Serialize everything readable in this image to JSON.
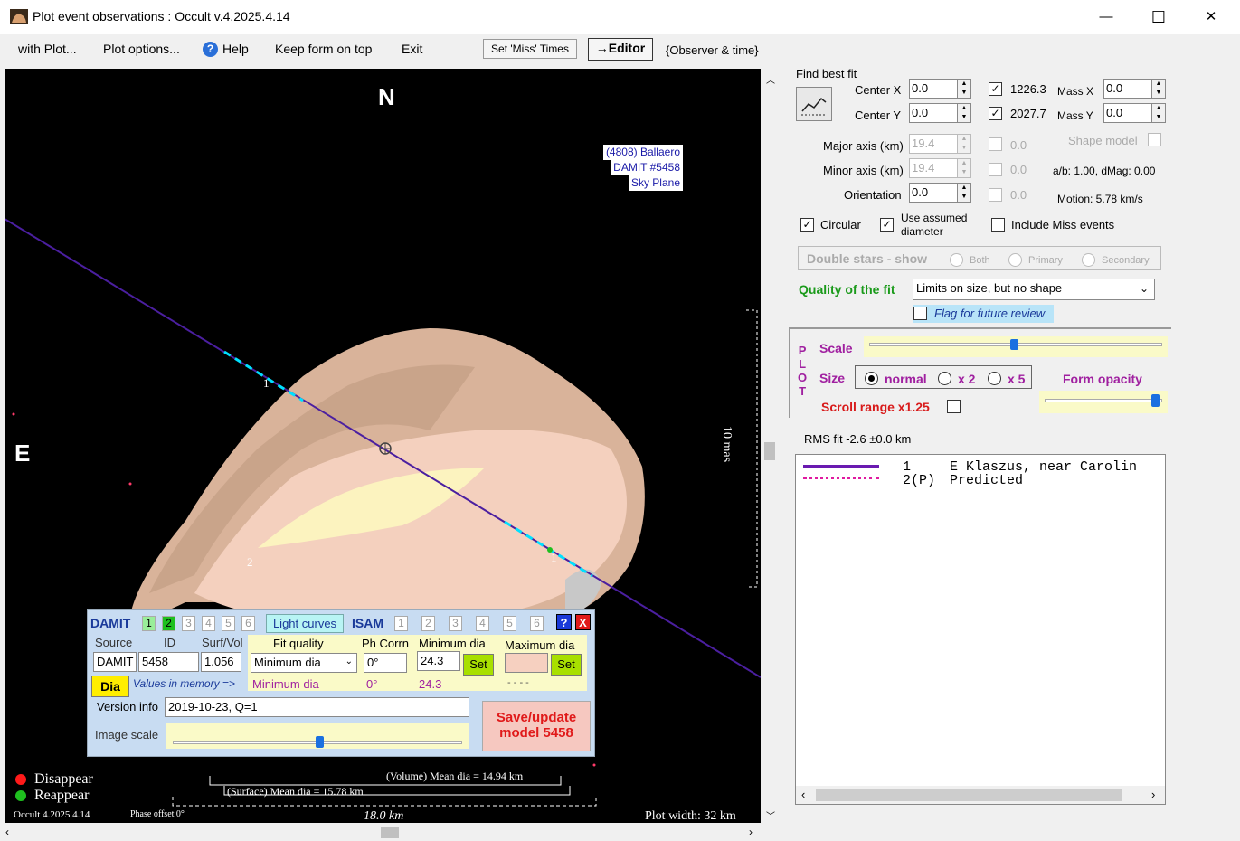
{
  "window": {
    "title": "Plot event observations : Occult v.4.2025.4.14",
    "min": "—",
    "max": "☐",
    "close": "✕"
  },
  "menu": {
    "with_plot": "with Plot...",
    "plot_options": "Plot options...",
    "help": "Help",
    "keep_on_top": "Keep form on top",
    "exit": "Exit"
  },
  "toolbar": {
    "set_miss_times": "Set 'Miss' Times",
    "editor": "→Editor",
    "observer_time": "{Observer & time}"
  },
  "plot": {
    "north": "N",
    "east": "E",
    "legend": [
      "(4808) Ballaero",
      "DAMIT #5458",
      "Sky Plane"
    ],
    "scale_label": "10 mas",
    "chord_label_1a": "1",
    "chord_label_1b": "1",
    "chord_label_2": "2",
    "disappear": "Disappear",
    "reappear": "Reappear",
    "volume_dia": "(Volume) Mean dia = 14.94 km",
    "surface_dia": "(Surface) Mean dia = 15.78 km",
    "length": "18.0 km",
    "footer_version": "Occult 4.2025.4.14",
    "phase_offset": "Phase offset 0°",
    "plot_width": "Plot width: 32 km",
    "colors": {
      "asteroid": "#e8c8b0",
      "chord": "#4b1fa0",
      "dash": "#00e0ff"
    }
  },
  "damit_panel": {
    "damit_label": "DAMIT",
    "damit_nums": [
      "1",
      "2",
      "3",
      "4",
      "5",
      "6"
    ],
    "light_curves": "Light curves",
    "isam_label": "ISAM",
    "isam_nums": [
      "1",
      "2",
      "3",
      "4",
      "5",
      "6"
    ],
    "help": "?",
    "close": "X",
    "source_label": "Source",
    "id_label": "ID",
    "surfvol_label": "Surf/Vol",
    "source_value": "DAMIT",
    "id_value": "5458",
    "surfvol_value": "1.056",
    "fit_quality_label": "Fit quality",
    "ph_corr_label": "Ph Corrn",
    "min_dia_label": "Minimum dia",
    "max_dia_label": "Maximum dia",
    "fit_quality_value": "Minimum dia",
    "ph_corr_value": "0°",
    "min_dia_value": "24.3",
    "set": "Set",
    "dia_btn": "Dia",
    "values_in_memory": "Values in memory =>",
    "mem_fit": "Minimum dia",
    "mem_ph": "0°",
    "mem_min": "24.3",
    "mem_max": "- - - -",
    "version_label": "Version info",
    "version_value": "2019-10-23, Q=1",
    "image_scale_label": "Image scale",
    "save_line1": "Save/update",
    "save_line2": "model 5458"
  },
  "right": {
    "find_best_fit": "Find best fit",
    "center_x_label": "Center X",
    "center_x": "0.0",
    "center_y_label": "Center Y",
    "center_y": "0.0",
    "cb_1226": "1226.3",
    "cb_2027": "2027.7",
    "mass_x_label": "Mass X",
    "mass_x": "0.0",
    "mass_y_label": "Mass Y",
    "mass_y": "0.0",
    "major_label": "Major axis (km)",
    "major": "19.4",
    "minor_label": "Minor axis (km)",
    "minor": "19.4",
    "orient_label": "Orientation",
    "orient": "0.0",
    "zero1": "0.0",
    "zero2": "0.0",
    "zero3": "0.0",
    "shape_model": "Shape model",
    "ab_dmag": "a/b: 1.00, dMag: 0.00",
    "motion": "Motion: 5.78 km/s",
    "circular": "Circular",
    "use_assumed_1": "Use assumed",
    "use_assumed_2": "diameter",
    "include_miss": "Include Miss events",
    "double_stars": "Double stars - show",
    "both": "Both",
    "primary": "Primary",
    "secondary": "Secondary",
    "quality_label": "Quality of the fit",
    "quality_value": "Limits on size, but no shape",
    "flag_review": "Flag for future review",
    "plot_letters": [
      "P",
      "L",
      "O",
      "T"
    ],
    "scale": "Scale",
    "size": "Size",
    "normal": "normal",
    "x2": "x 2",
    "x5": "x 5",
    "form_opacity": "Form opacity",
    "scroll_range": "Scroll range x1.25",
    "rms": "RMS fit -2.6 ±0.0 km",
    "list": [
      {
        "num": "1",
        "name": "E Klaszus, near Carolin"
      },
      {
        "num": "2(P)",
        "name": "Predicted"
      }
    ]
  }
}
